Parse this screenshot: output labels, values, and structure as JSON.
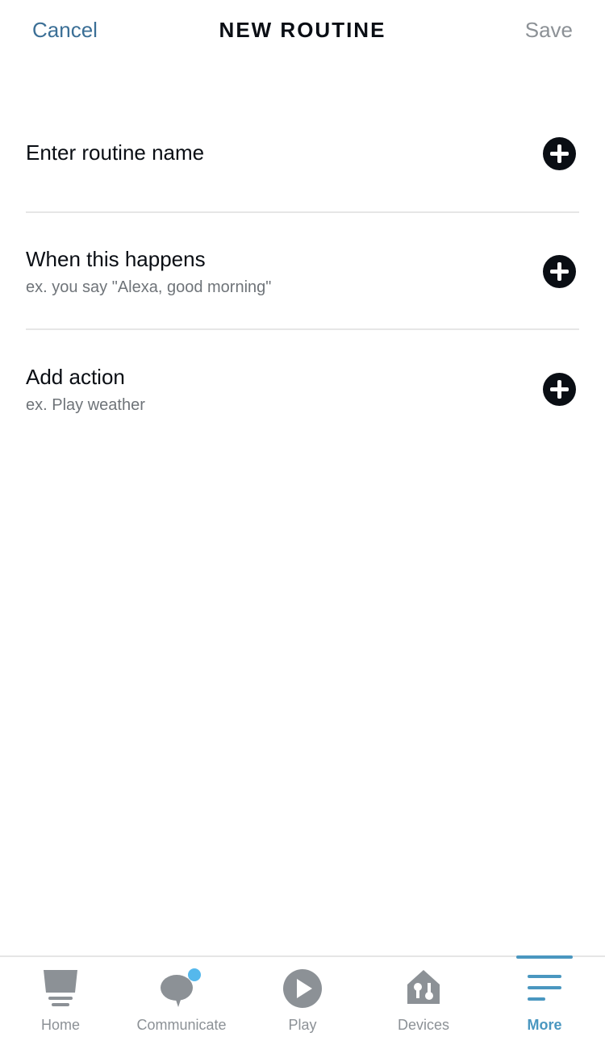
{
  "header": {
    "cancel_label": "Cancel",
    "title": "NEW ROUTINE",
    "save_label": "Save"
  },
  "rows": [
    {
      "label": "Enter routine name",
      "sub": ""
    },
    {
      "label": "When this happens",
      "sub": "ex. you say \"Alexa, good morning\""
    },
    {
      "label": "Add action",
      "sub": "ex. Play weather"
    }
  ],
  "tabbar": {
    "tabs": [
      {
        "label": "Home",
        "icon": "home-icon"
      },
      {
        "label": "Communicate",
        "icon": "communicate-icon",
        "badge": true
      },
      {
        "label": "Play",
        "icon": "play-icon"
      },
      {
        "label": "Devices",
        "icon": "devices-icon"
      },
      {
        "label": "More",
        "icon": "more-icon",
        "active": true
      }
    ]
  },
  "colors": {
    "accent": "#4a97c0",
    "cancel": "#3b6f96",
    "inactive": "#8c9196",
    "badge": "#55b8ec"
  }
}
